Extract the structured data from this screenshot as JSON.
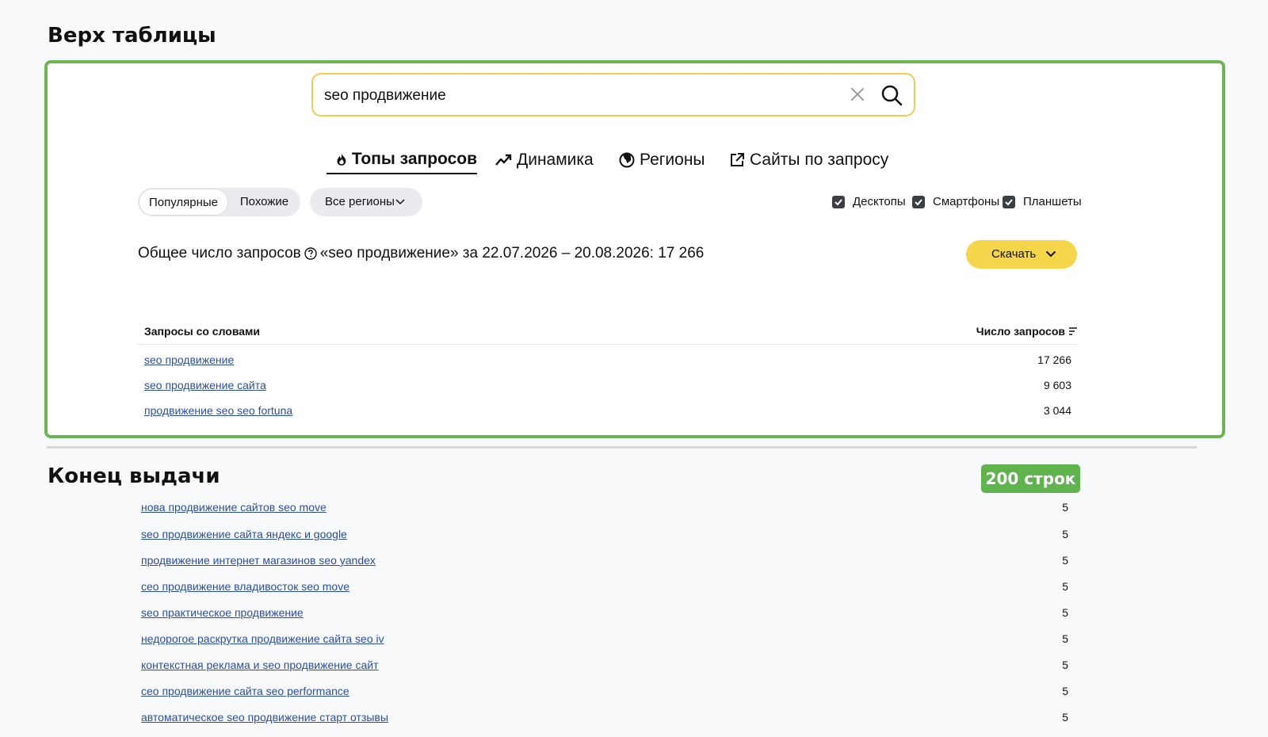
{
  "sections": {
    "top_title": "Верх таблицы",
    "end_title": "Конец выдачи",
    "rows_badge": "200 строк"
  },
  "search": {
    "value": "seo продвижение"
  },
  "tabs": [
    {
      "label": "Топы запросов",
      "icon": "fire-icon",
      "active": true
    },
    {
      "label": "Динамика",
      "icon": "trend-icon",
      "active": false
    },
    {
      "label": "Регионы",
      "icon": "globe-icon",
      "active": false
    },
    {
      "label": "Сайты по запросу",
      "icon": "external-link-icon",
      "active": false
    }
  ],
  "filters": {
    "popular": "Популярные",
    "similar": "Похожие",
    "regions": "Все регионы",
    "devices": [
      {
        "label": "Десктопы",
        "checked": true
      },
      {
        "label": "Смартфоны",
        "checked": true
      },
      {
        "label": "Планшеты",
        "checked": true
      }
    ]
  },
  "summary": {
    "prefix": "Общее число запросов",
    "text": "«seo продвижение» за 22.07.2026 – 20.08.2026: 17 266"
  },
  "download": {
    "label": "Скачать"
  },
  "table": {
    "col_query": "Запросы со словами",
    "col_count": "Число запросов",
    "top_rows": [
      {
        "query": "seo продвижение",
        "count": "17 266"
      },
      {
        "query": "seo продвижение сайта",
        "count": "9 603"
      },
      {
        "query": "продвижение seo seo fortuna",
        "count": "3 044"
      }
    ],
    "bottom_rows": [
      {
        "query": "нова продвижение сайтов seo move",
        "count": "5"
      },
      {
        "query": "seo продвижение сайта яндекс и google",
        "count": "5"
      },
      {
        "query": "продвижение интернет магазинов seo yandex",
        "count": "5"
      },
      {
        "query": "сео продвижение владивосток seo move",
        "count": "5"
      },
      {
        "query": "seo практическое продвижение",
        "count": "5"
      },
      {
        "query": "недорогое раскрутка продвижение сайта seo iv",
        "count": "5"
      },
      {
        "query": "контекстная реклама и seo продвижение сайт",
        "count": "5"
      },
      {
        "query": "сео продвижение сайта seo performance",
        "count": "5"
      },
      {
        "query": "автоматическое seo продвижение старт отзывы",
        "count": "5"
      }
    ]
  },
  "colors": {
    "frame": "#6cb552",
    "search_border": "#f3cc4c",
    "download_bg": "#f5d54a",
    "link": "#2b4ea0",
    "badge": "#5fb44e"
  }
}
